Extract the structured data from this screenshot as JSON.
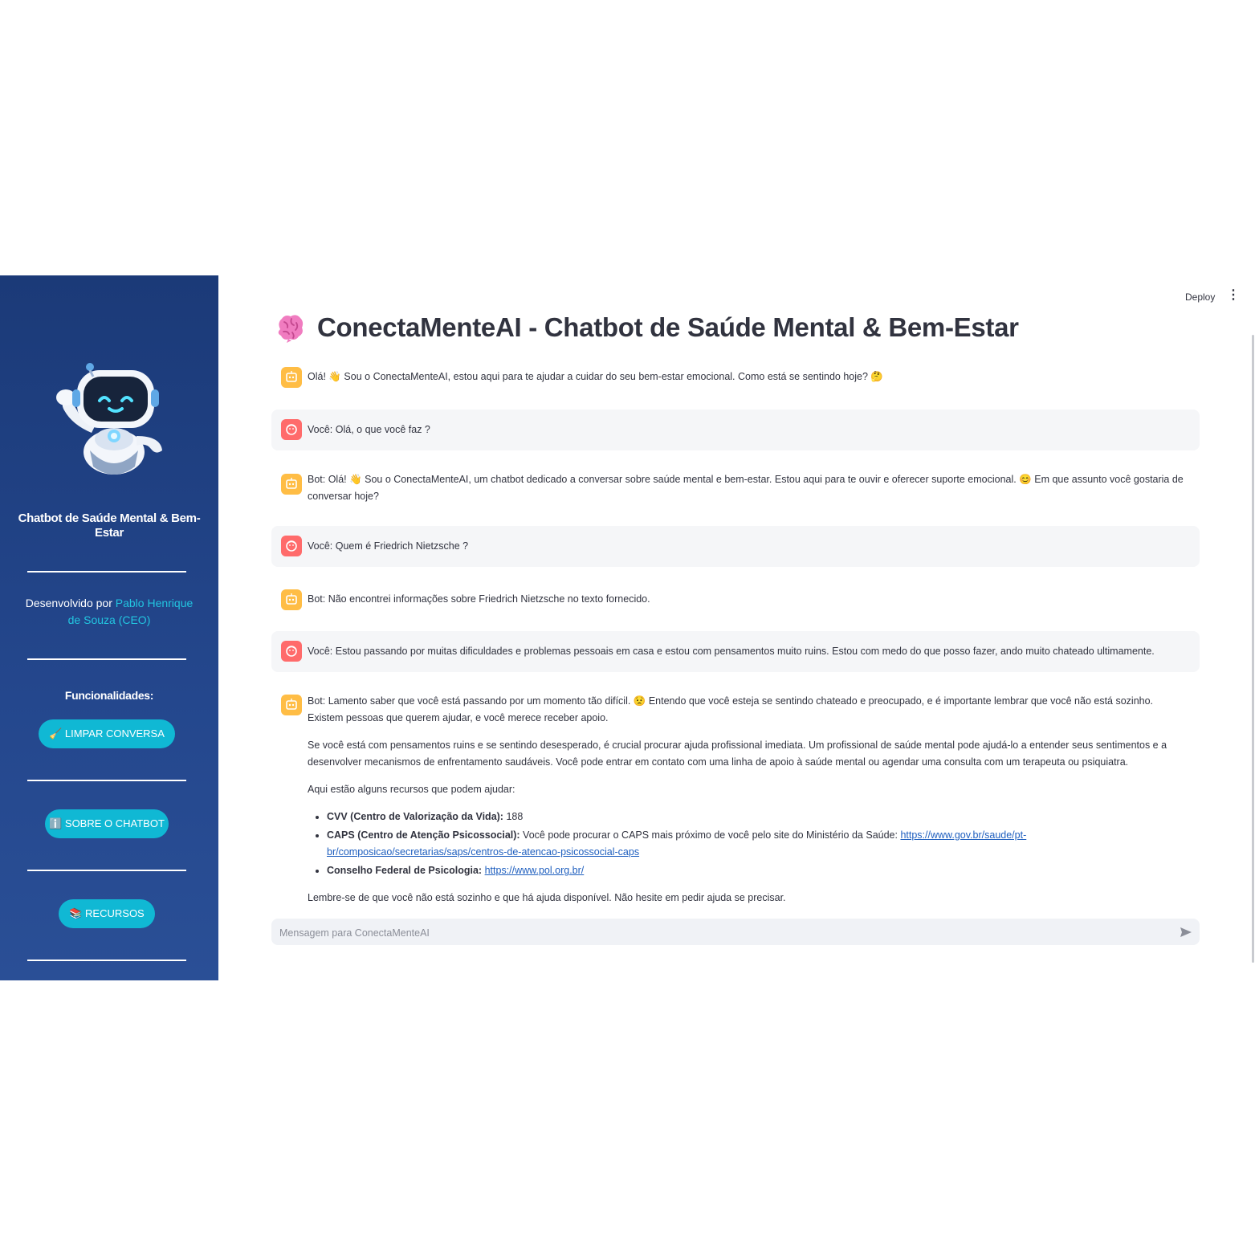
{
  "sidebar": {
    "title": "Chatbot de Saúde Mental & Bem-Estar",
    "dev_prefix": "Desenvolvido por ",
    "dev_name": "Pablo Henrique de Souza (CEO)",
    "functions_heading": "Funcionalidades:",
    "buttons": {
      "clear": "🧹 LIMPAR CONVERSA",
      "about": "ℹ️ SOBRE O CHATBOT",
      "resources": "📚 RECURSOS"
    }
  },
  "header": {
    "deploy": "Deploy",
    "menu": "⋮"
  },
  "page_title": "ConectaMenteAI - Chatbot de Saúde Mental & Bem-Estar",
  "messages": {
    "m1": "Olá! 👋 Sou o ConectaMenteAI, estou aqui para te ajudar a cuidar do seu bem-estar emocional. Como está se sentindo hoje? 🤔",
    "m2": "Você: Olá, o que você faz ?",
    "m3": "Bot: Olá! 👋 Sou o ConectaMenteAI, um chatbot dedicado a conversar sobre saúde mental e bem-estar. Estou aqui para te ouvir e oferecer suporte emocional. 😊 Em que assunto você gostaria de conversar hoje?",
    "m4": "Você: Quem é Friedrich Nietzsche ?",
    "m5": "Bot: Não encontrei informações sobre Friedrich Nietzsche no texto fornecido.",
    "m6": "Você: Estou passando por muitas dificuldades e problemas pessoais em casa e estou com pensamentos muito ruins. Estou com medo do que posso fazer, ando muito chateado ultimamente.",
    "m7": {
      "p1": "Bot: Lamento saber que você está passando por um momento tão difícil. 😟 Entendo que você esteja se sentindo chateado e preocupado, e é importante lembrar que você não está sozinho. Existem pessoas que querem ajudar, e você merece receber apoio.",
      "p2": "Se você está com pensamentos ruins e se sentindo desesperado, é crucial procurar ajuda profissional imediata. Um profissional de saúde mental pode ajudá-lo a entender seus sentimentos e a desenvolver mecanismos de enfrentamento saudáveis. Você pode entrar em contato com uma linha de apoio à saúde mental ou agendar uma consulta com um terapeuta ou psiquiatra.",
      "p3": "Aqui estão alguns recursos que podem ajudar:",
      "items": [
        {
          "label": "CVV (Centro de Valorização da Vida):",
          "text": " 188",
          "link": ""
        },
        {
          "label": "CAPS (Centro de Atenção Psicossocial):",
          "text": " Você pode procurar o CAPS mais próximo de você pelo site do Ministério da Saúde: ",
          "link": "https://www.gov.br/saude/pt-br/composicao/secretarias/saps/centros-de-atencao-psicossocial-caps"
        },
        {
          "label": "Conselho Federal de Psicologia:",
          "text": " ",
          "link": "https://www.pol.org.br/"
        }
      ],
      "p4": "Lembre-se de que você não está sozinho e que há ajuda disponível. Não hesite em pedir ajuda se precisar."
    }
  },
  "chat_input": {
    "placeholder": "Mensagem para ConectaMenteAI"
  },
  "colors": {
    "sidebar_bg": "#1f3f80",
    "button": "#10b8d4",
    "link": "#22c5e0",
    "bot_avatar": "#ffbd45",
    "user_avatar": "#ff6b6b"
  },
  "icons": {
    "robot": "robot-mascot-icon",
    "brain": "brain-icon",
    "bot_avatar": "smart-toy-icon",
    "user_avatar": "face-icon",
    "send": "send-icon"
  }
}
